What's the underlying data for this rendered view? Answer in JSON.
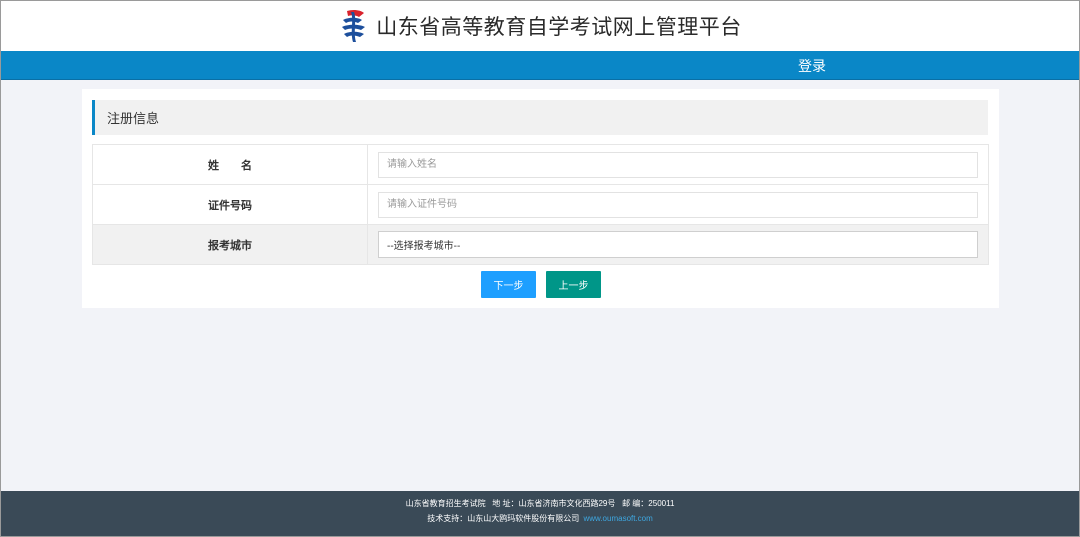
{
  "header": {
    "title": "山东省高等教育自学考试网上管理平台",
    "logo_icon": "exam-logo-icon"
  },
  "navbar": {
    "login_label": "登录",
    "color": "#0a87c7"
  },
  "section": {
    "title": "注册信息"
  },
  "form": {
    "name": {
      "label": "姓　　名",
      "placeholder": "请输入姓名",
      "value": ""
    },
    "id_number": {
      "label": "证件号码",
      "placeholder": "请输入证件号码",
      "value": ""
    },
    "city": {
      "label": "报考城市",
      "selected": "--选择报考城市--"
    }
  },
  "buttons": {
    "next_label": "下一步",
    "prev_label": "上一步",
    "next_color": "#1e9fff",
    "prev_color": "#009688"
  },
  "footer": {
    "org": "山东省教育招生考试院",
    "address_label": "地 址：",
    "address": "山东省济南市文化西路29号",
    "postcode_label": "邮 编：",
    "postcode": "250011",
    "support_label": "技术支持：",
    "support_company": "山东山大鸥玛软件股份有限公司",
    "support_url": "www.oumasoft.com"
  }
}
